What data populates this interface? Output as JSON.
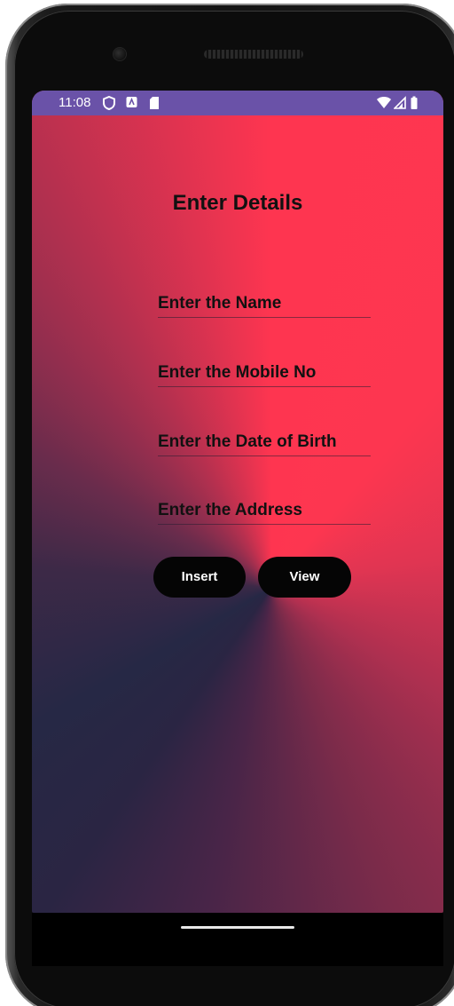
{
  "status_bar": {
    "time": "11:08",
    "left_icons": [
      "shield-icon",
      "notification-a-icon",
      "sd-card-icon"
    ],
    "right_icons": [
      "wifi-icon",
      "signal-icon",
      "battery-icon"
    ],
    "color": "#6a52a8"
  },
  "form": {
    "title": "Enter Details",
    "fields": [
      {
        "placeholder": "Enter the Name",
        "value": ""
      },
      {
        "placeholder": "Enter the Mobile No",
        "value": ""
      },
      {
        "placeholder": "Enter the Date of Birth",
        "value": ""
      },
      {
        "placeholder": "Enter the Address",
        "value": ""
      }
    ],
    "buttons": {
      "insert_label": "Insert",
      "view_label": "View"
    }
  },
  "colors": {
    "gradient_warm": "#fe3550",
    "gradient_cool": "#262845",
    "button_bg": "#050505"
  }
}
